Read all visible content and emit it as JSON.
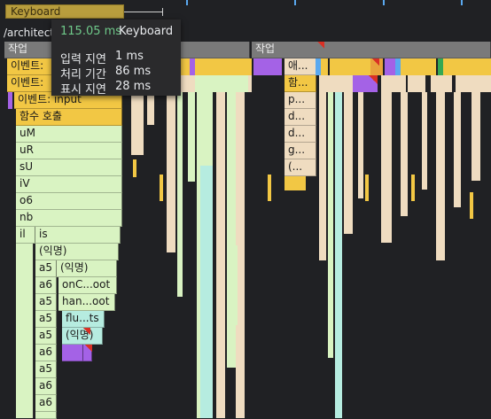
{
  "overview": {
    "track_label": "Keyboard"
  },
  "thread_label": "/architect",
  "tooltip": {
    "duration": "115.05 ms",
    "name": "Keyboard",
    "rows": [
      {
        "label": "입력 지연",
        "value": "1 ms"
      },
      {
        "label": "처리 기간",
        "value": "86 ms"
      },
      {
        "label": "표시 지연",
        "value": "28 ms"
      }
    ]
  },
  "flame": {
    "task_left": "작업",
    "task_right": "작업",
    "event_1": "이벤트:",
    "event_2": "이벤트:",
    "event_input": "이벤트: input",
    "function_call": "함수 호출",
    "stack": [
      "uM",
      "uR",
      "sU",
      "iV",
      "o6",
      "nb",
      "il"
    ],
    "il_child": "is",
    "anon": "(익명)",
    "a5_1": "a5",
    "a5_1_child": "(익명)",
    "a6_1": "a6",
    "a6_1_child": "onC...oot",
    "a5_2": "a5",
    "a5_2_child": "han...oot",
    "a5_3": "a5",
    "a5_3_child": "flu...ts",
    "a5_4": "a5",
    "a5_4_child": "(익명)",
    "a6_2": "a6",
    "a5_5": "a5",
    "a6_3": "a6",
    "a6_4": "a6",
    "right_col_a": [
      "애...",
      "함...",
      "p...",
      "d...",
      "d...",
      "g...",
      "(..."
    ]
  },
  "colors": {
    "task": "#7a7a7a",
    "event": "#f2c744",
    "script_light": "#d9f3c2",
    "paint": "#efdcc0",
    "layout": "#b6ece0",
    "rendering": "#a462e6",
    "tooltip_duration": "#6fc98a"
  }
}
